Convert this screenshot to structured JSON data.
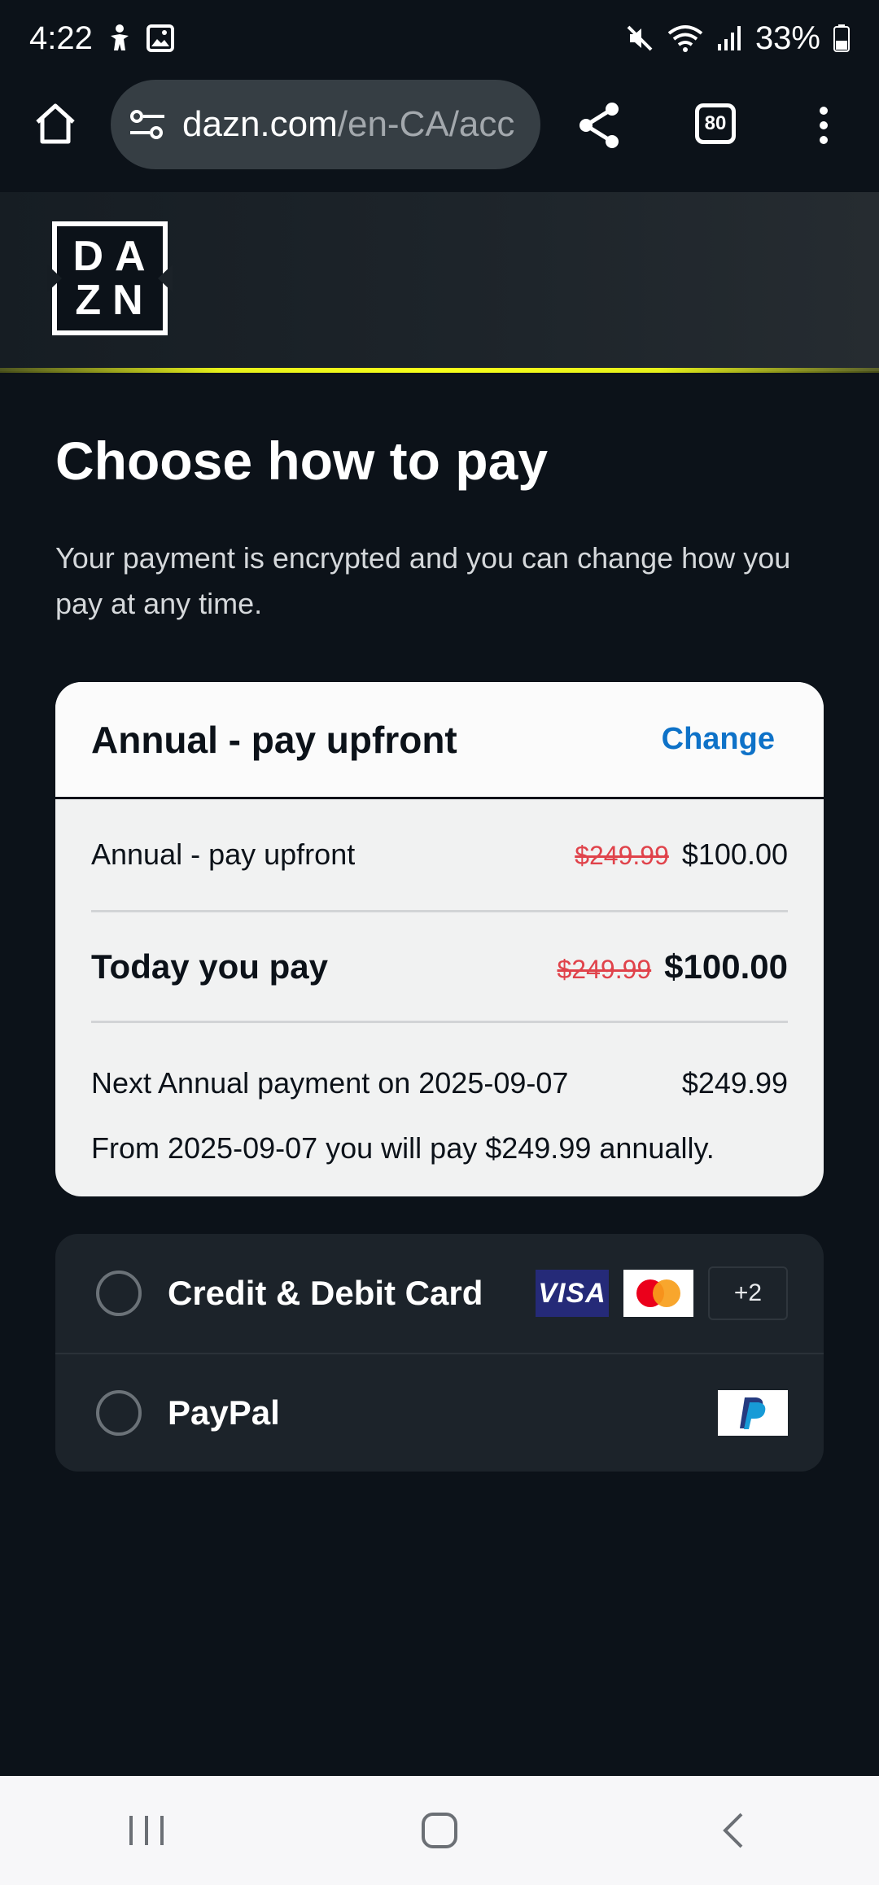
{
  "status_bar": {
    "time": "4:22",
    "battery": "33%"
  },
  "browser": {
    "url_host": "dazn.com",
    "url_path": "/en-CA/acc",
    "tab_count": "80"
  },
  "header": {
    "logo_line1": "DA",
    "logo_line2": "ZN",
    "accent_color": "#f7ff1a"
  },
  "main": {
    "title": "Choose how to pay",
    "subtitle": "Your payment is encrypted and you can change how you pay at any time."
  },
  "plan": {
    "name": "Annual - pay upfront",
    "change_label": "Change",
    "line_item": {
      "label": "Annual - pay upfront",
      "old_price": "$249.99",
      "price": "$100.00"
    },
    "today": {
      "label": "Today you pay",
      "old_price": "$249.99",
      "price": "$100.00"
    },
    "next": {
      "label": "Next Annual payment on 2025-09-07",
      "price": "$249.99"
    },
    "note": "From 2025-09-07 you will pay $249.99 annually."
  },
  "payment_methods": {
    "card": {
      "label": "Credit & Debit Card",
      "visa": "VISA",
      "more": "+2"
    },
    "paypal": {
      "label": "PayPal"
    }
  },
  "colors": {
    "background": "#0c1219",
    "link": "#0e72c8",
    "strike": "#e0434b"
  }
}
